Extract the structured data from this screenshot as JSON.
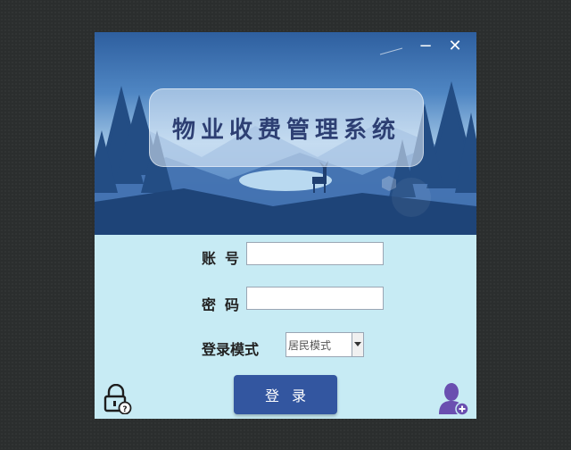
{
  "window": {
    "title": "物业收费管理系统",
    "minimize_label": "−",
    "close_label": "✕"
  },
  "form": {
    "account_label": "账号",
    "password_label": "密码",
    "mode_label": "登录模式",
    "account_value": "",
    "password_value": "",
    "mode_selected": "居民模式"
  },
  "actions": {
    "login_label": "登录"
  },
  "icons": {
    "lock": "lock-question-icon",
    "user": "add-user-icon"
  },
  "colors": {
    "login_button": "#3356a0",
    "form_background": "#c7ebf4",
    "icon_purple": "#6a4fb0"
  }
}
